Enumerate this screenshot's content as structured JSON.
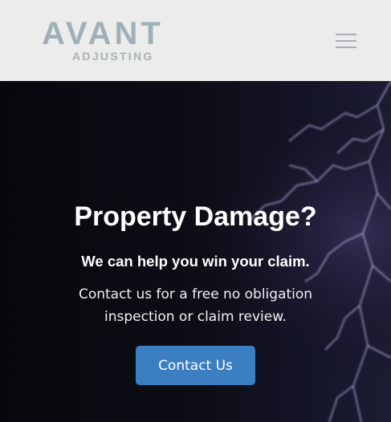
{
  "header": {
    "logo": {
      "main": "AVANT",
      "sub": "ADJUSTING"
    },
    "menu_icon": "hamburger-menu-icon"
  },
  "hero": {
    "title": "Property Damage?",
    "subtitle": "We can help you win your claim.",
    "text": "Contact us for a free no obligation inspection or claim review.",
    "cta_label": "Contact Us",
    "background_image": "lightning-storm"
  },
  "colors": {
    "header_bg": "#ececec",
    "logo": "#9fb0b8",
    "hero_bg": "#0a0a12",
    "cta_bg": "#3b7fc2",
    "text": "#ffffff"
  }
}
